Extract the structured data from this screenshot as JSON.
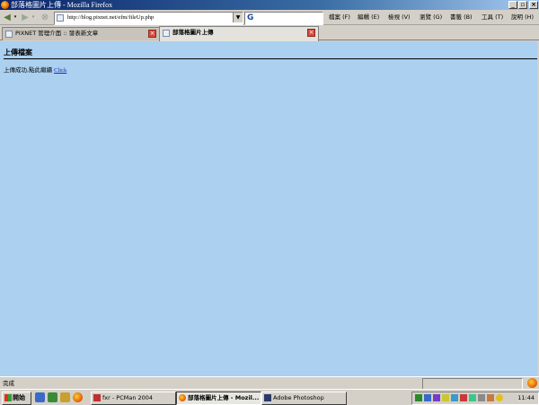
{
  "window": {
    "title": "部落格圖片上傳 - Mozilla Firefox",
    "minimize_glyph": "_",
    "maximize_glyph": "▫",
    "close_glyph": "×"
  },
  "toolbar": {
    "back_glyph": "◀",
    "forward_glyph": "▶",
    "stop_glyph": "⊗",
    "url": "http://blog.pixnet.net/efm/fileUp.php",
    "url_drop_glyph": "▼",
    "search_engine_glyph": "G",
    "search_value": ""
  },
  "menu": {
    "items": [
      "檔案 (F)",
      "編輯 (E)",
      "檢視 (V)",
      "瀏覽 (G)",
      "書籤 (B)",
      "工具 (T)",
      "說明 (H)"
    ]
  },
  "tabs": [
    {
      "label": "PIXNET 管理介面 :: 發表新文章",
      "close_glyph": "×",
      "active": false
    },
    {
      "label": "部落格圖片上傳",
      "close_glyph": "×",
      "active": true
    }
  ],
  "page": {
    "heading": "上傳檔案",
    "message": "上傳成功,點此繼續 ",
    "link_text": "Click"
  },
  "statusbar": {
    "text": "完成"
  },
  "taskbar": {
    "start_label": "開始",
    "tasks": [
      {
        "label": "fxr - PCMan 2004",
        "icon": "pcman-icon"
      },
      {
        "label": "部落格圖片上傳 - Mozil...",
        "icon": "firefox-icon"
      },
      {
        "label": "Adobe Photoshop",
        "icon": "photoshop-icon"
      }
    ],
    "clock": "11:44"
  },
  "colors": {
    "page_bg": "#abd0f0",
    "chrome": "#d4d0c8",
    "titlebar_start": "#0a246a",
    "link": "#2020c0",
    "tab_close": "#d84a3a"
  }
}
